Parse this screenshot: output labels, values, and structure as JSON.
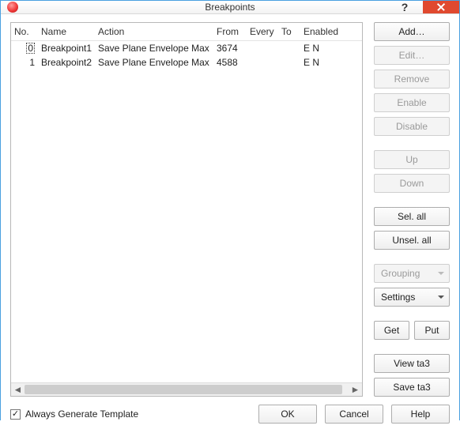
{
  "window": {
    "title": "Breakpoints",
    "help_glyph": "?"
  },
  "grid": {
    "columns": {
      "no": "No.",
      "name": "Name",
      "action": "Action",
      "from": "From",
      "every": "Every",
      "to": "To",
      "enabled": "Enabled"
    },
    "rows": [
      {
        "no": "0",
        "name": "Breakpoint1",
        "action": "Save Plane Envelope Max",
        "from": "3674",
        "every": "",
        "to": "",
        "enabled": "E N"
      },
      {
        "no": "1",
        "name": "Breakpoint2",
        "action": "Save Plane Envelope Max",
        "from": "4588",
        "every": "",
        "to": "",
        "enabled": "E N"
      }
    ],
    "scroll": {
      "left_glyph": "◄",
      "right_glyph": "►"
    }
  },
  "side": {
    "add": "Add…",
    "edit": "Edit…",
    "remove": "Remove",
    "enable": "Enable",
    "disable": "Disable",
    "up": "Up",
    "down": "Down",
    "sel_all": "Sel. all",
    "unsel_all": "Unsel. all",
    "grouping": "Grouping",
    "settings": "Settings",
    "get": "Get",
    "put": "Put",
    "view_ta3": "View ta3",
    "save_ta3": "Save ta3"
  },
  "footer": {
    "checkbox_label": "Always Generate Template",
    "checkbox_checked_glyph": "✓",
    "ok": "OK",
    "cancel": "Cancel",
    "help": "Help"
  }
}
